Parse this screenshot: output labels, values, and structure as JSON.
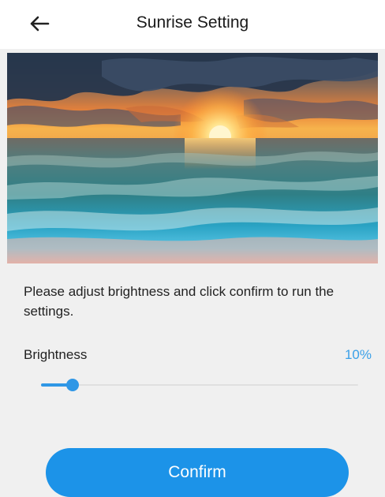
{
  "header": {
    "title": "Sunrise Setting",
    "back_icon": "arrow-left-icon"
  },
  "hero": {
    "scene": "sunrise over ocean waves"
  },
  "instruction": "Please adjust brightness and click confirm to run the settings.",
  "brightness": {
    "label": "Brightness",
    "value_text": "10%",
    "value": 0.1
  },
  "confirm_label": "Confirm",
  "colors": {
    "accent": "#2f97e6",
    "button": "#1c93e8",
    "value_text": "#3aa0e8",
    "background": "#f0f0f0"
  }
}
